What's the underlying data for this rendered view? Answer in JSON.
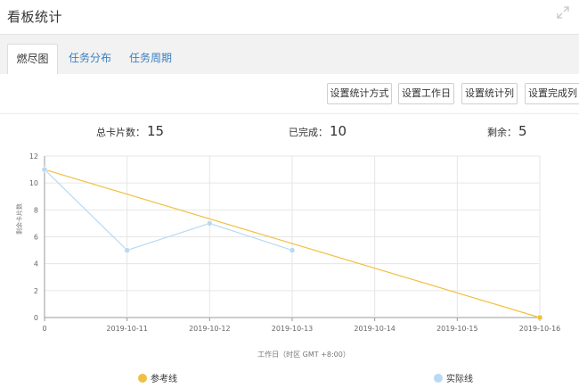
{
  "header": {
    "title": "看板统计"
  },
  "tabs": [
    {
      "label": "燃尽图",
      "active": true
    },
    {
      "label": "任务分布",
      "active": false
    },
    {
      "label": "任务周期",
      "active": false
    }
  ],
  "toolbar": {
    "buttons": [
      "设置统计方式",
      "设置工作日",
      "设置统计列",
      "设置完成列"
    ]
  },
  "stats": {
    "total_label": "总卡片数：",
    "total_value": "15",
    "done_label": "已完成：",
    "done_value": "10",
    "remain_label": "剩余：",
    "remain_value": "5"
  },
  "chart_data": {
    "type": "line",
    "xlabel": "工作日（时区 GMT +8:00）",
    "ylabel": "剩余卡片数",
    "categories": [
      "0",
      "2019-10-11",
      "2019-10-12",
      "2019-10-13",
      "2019-10-14",
      "2019-10-15",
      "2019-10-16"
    ],
    "ylim": [
      0,
      12
    ],
    "yticks": [
      0,
      2,
      4,
      6,
      8,
      10,
      12
    ],
    "grid": true,
    "legend_position": "bottom",
    "series": [
      {
        "name": "参考线",
        "color": "#f0c040",
        "values": [
          11,
          null,
          null,
          null,
          null,
          null,
          0
        ],
        "connect": "straight"
      },
      {
        "name": "实际线",
        "color": "#b8daf2",
        "values": [
          11,
          5,
          7,
          5,
          null,
          null,
          null
        ]
      }
    ]
  }
}
